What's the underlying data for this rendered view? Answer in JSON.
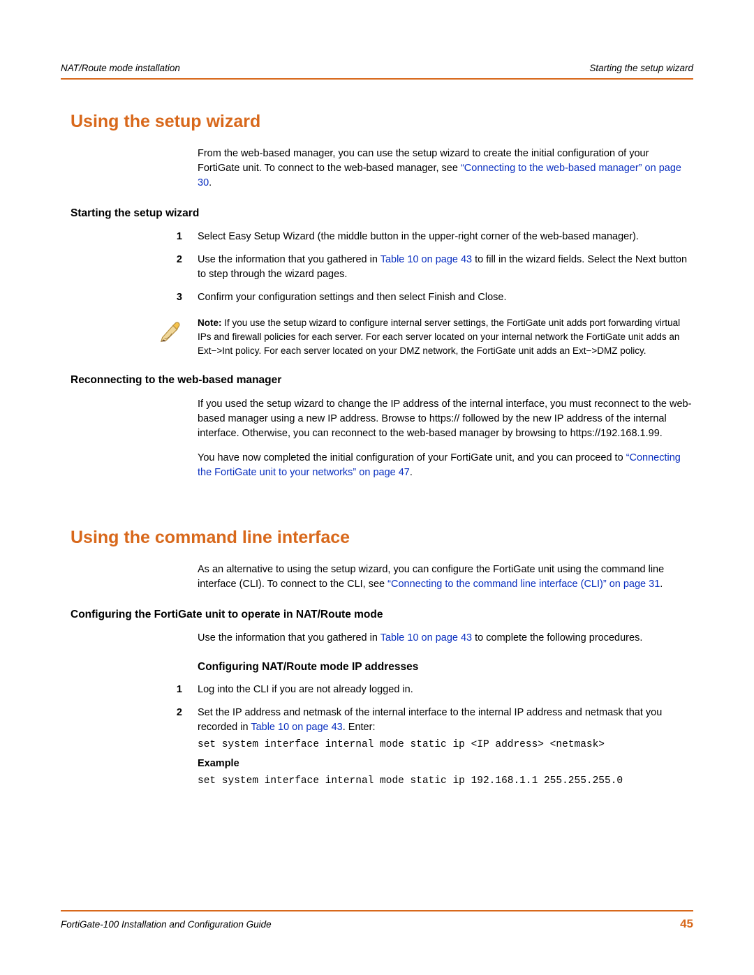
{
  "header": {
    "left": "NAT/Route mode installation",
    "right": "Starting the setup wizard"
  },
  "s1": {
    "title": "Using the setup wizard",
    "intro_a": "From the web-based manager, you can use the setup wizard to create the initial configuration of your FortiGate unit. To connect to the web-based manager, see ",
    "intro_link": "“Connecting to the web-based manager” on page 30",
    "intro_b": ".",
    "sub1": {
      "title": "Starting the setup wizard",
      "step1": "Select Easy Setup Wizard (the middle button in the upper-right corner of the web-based manager).",
      "step2_a": "Use the information that you gathered in ",
      "step2_link": "Table 10 on page 43",
      "step2_b": " to fill in the wizard fields. Select the Next button to step through the wizard pages.",
      "step3": "Confirm your configuration settings and then select Finish and Close.",
      "note_lead": "Note: ",
      "note_body": "If you use the setup wizard to configure internal server settings, the FortiGate unit adds port forwarding virtual IPs and firewall policies for each server. For each server located on your internal network the FortiGate unit adds an Ext−>Int policy. For each server located on your DMZ network, the FortiGate unit adds an Ext−>DMZ policy."
    },
    "sub2": {
      "title": "Reconnecting to the web-based manager",
      "p1": "If you used the setup wizard to change the IP address of the internal interface, you must reconnect to the web-based manager using a new IP address. Browse to https:// followed by the new IP address of the internal interface. Otherwise, you can reconnect to the web-based manager by browsing to https://192.168.1.99.",
      "p2_a": "You have now completed the initial configuration of your FortiGate unit, and you can proceed to ",
      "p2_link": "“Connecting the FortiGate unit to your networks” on page 47",
      "p2_b": "."
    }
  },
  "s2": {
    "title": "Using the command line interface",
    "intro_a": "As an alternative to using the setup wizard, you can configure the FortiGate unit using the command line interface (CLI). To connect to the CLI, see ",
    "intro_link": "“Connecting to the command line interface (CLI)” on page 31",
    "intro_b": ".",
    "sub1": {
      "title": "Configuring the FortiGate unit to operate in NAT/Route mode",
      "p_a": "Use the information that you gathered in ",
      "p_link": "Table 10 on page 43",
      "p_b": " to complete the following procedures."
    },
    "sub2": {
      "title": "Configuring NAT/Route mode IP addresses",
      "step1": "Log into the CLI if you are not already logged in.",
      "step2_a": "Set the IP address and netmask of the internal interface to the internal IP address and netmask that you recorded in ",
      "step2_link": "Table 10 on page 43",
      "step2_b": ". Enter:",
      "code1": "set system interface internal mode static ip <IP address> <netmask>",
      "example_label": "Example",
      "code2": "set system interface internal mode static ip 192.168.1.1 255.255.255.0"
    }
  },
  "footer": {
    "left": "FortiGate-100 Installation and Configuration Guide",
    "page": "45"
  }
}
